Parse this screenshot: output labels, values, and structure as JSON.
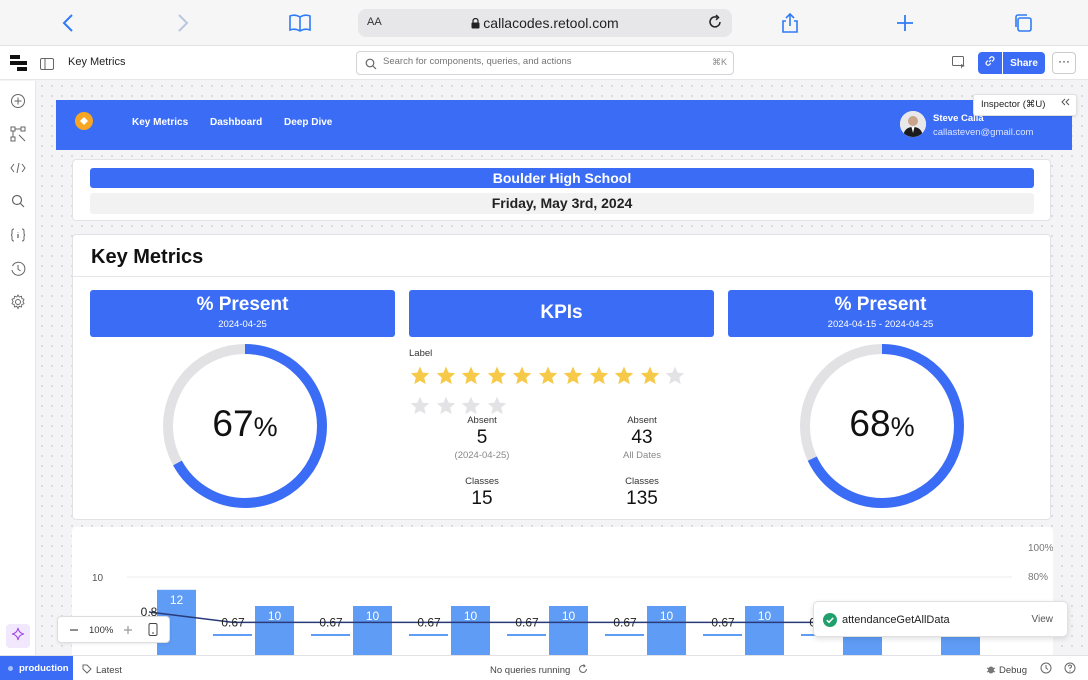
{
  "browser": {
    "aa_label": "AA",
    "url": "callacodes.retool.com"
  },
  "editor": {
    "page_name": "Key Metrics",
    "search_placeholder": "Search for components, queries, and actions",
    "search_shortcut": "⌘K",
    "share_label": "Share",
    "more_label": "···",
    "inspector_label": "Inspector (⌘U)",
    "zoom": "100%"
  },
  "app": {
    "nav": [
      "Key Metrics",
      "Dashboard",
      "Deep Dive"
    ],
    "user_name": "Steve Calla",
    "user_email": "callasteven@gmail.com",
    "school": "Boulder High School",
    "date": "Friday, May 3rd, 2024",
    "metrics_title": "Key Metrics",
    "left_panel": {
      "title": "% Present",
      "subtitle": "2024-04-25",
      "value": "67",
      "unit": "%",
      "fraction": 0.67
    },
    "mid_panel": {
      "title": "KPIs"
    },
    "right_panel": {
      "title": "% Present",
      "subtitle": "2024-04-15 - 2024-04-25",
      "value": "68",
      "unit": "%",
      "fraction": 0.68
    },
    "kpi_label": "Label",
    "rating": {
      "value": 10,
      "max": 15
    },
    "stats": [
      {
        "label": "Absent",
        "value": "5",
        "sub": "(2024-04-25)"
      },
      {
        "label": "Absent",
        "value": "43",
        "sub": "All Dates"
      },
      {
        "label": "Classes",
        "value": "15",
        "sub": ""
      },
      {
        "label": "Classes",
        "value": "135",
        "sub": ""
      }
    ],
    "colors": {
      "primary": "#3b6cf6",
      "star": "#f7c948",
      "star_empty": "#e3e3e6",
      "gauge_track": "#e2e2e4",
      "line": "#2a3a7a",
      "bar": "#5e9cf5"
    }
  },
  "chart_data": {
    "type": "bar",
    "bars": [
      12,
      10,
      10,
      10,
      10,
      10,
      10,
      10,
      10
    ],
    "bar_labels": [
      "12",
      "10",
      "10",
      "10",
      "10",
      "10",
      "10",
      "10",
      "10"
    ],
    "line_values": [
      0.8,
      0.67,
      0.67,
      0.67,
      0.67,
      0.67,
      0.67,
      0.67,
      0.67
    ],
    "line_labels": [
      "0.8",
      "0.67",
      "0.67",
      "0.67",
      "0.67",
      "0.67",
      "0.67",
      "0.67",
      "0.67"
    ],
    "y_left_ticks": [
      "10"
    ],
    "y_right_ticks": [
      "100%",
      "80%"
    ]
  },
  "toast": {
    "text": "attendanceGetAllData",
    "action": "View"
  },
  "status_bar": {
    "environment": "production",
    "version": "Latest",
    "queries": "No queries running",
    "debug": "Debug"
  }
}
